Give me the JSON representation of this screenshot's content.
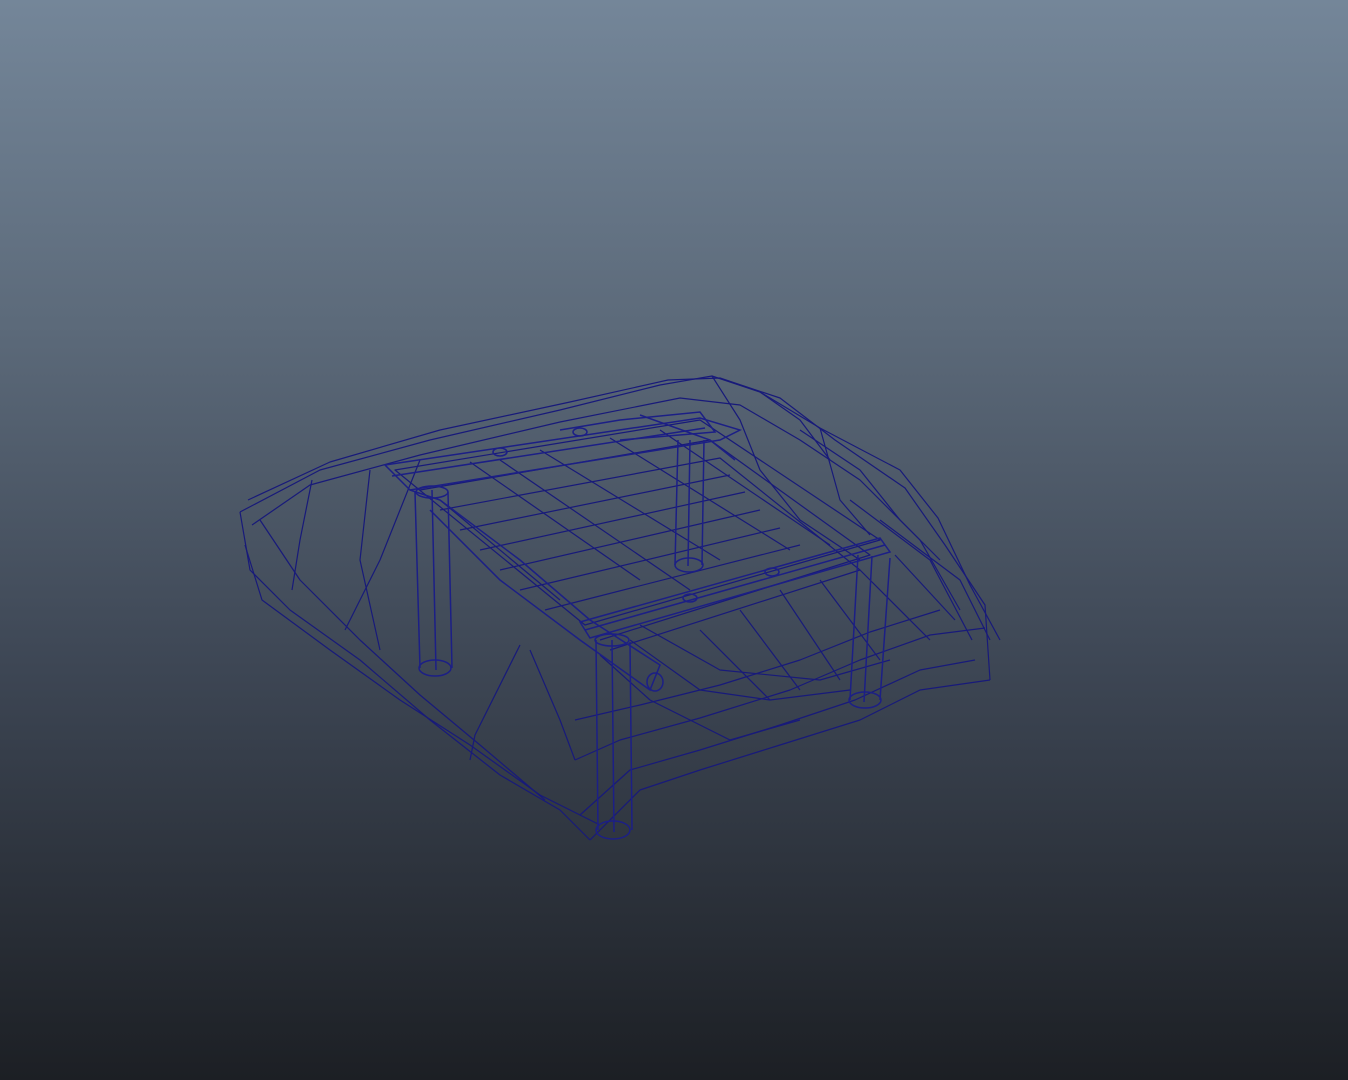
{
  "viewport": {
    "background_top": "#748699",
    "background_bottom": "#1c1f24",
    "wireframe_color": "#181a7a"
  },
  "model": {
    "kind": "wireframe",
    "description_visible": ""
  }
}
